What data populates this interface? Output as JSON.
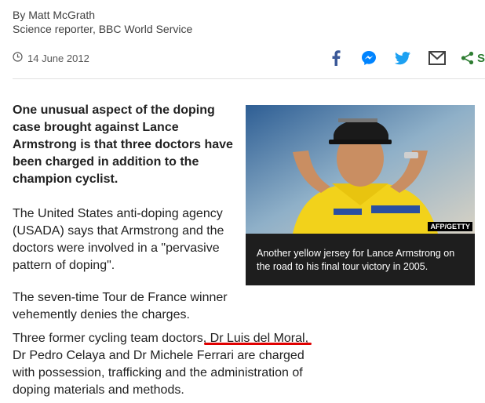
{
  "byline": {
    "author": "By Matt McGrath",
    "role": "Science reporter, BBC World Service"
  },
  "meta": {
    "date": "14 June 2012",
    "icons": [
      "clock-icon",
      "facebook-icon",
      "messenger-icon",
      "twitter-icon",
      "email-icon",
      "share-icon"
    ],
    "share_label": "S"
  },
  "article": {
    "lead": "One unusual aspect of the doping case brought against Lance Armstrong is that three doctors have been charged in addition to the champion cyclist.",
    "p1": "The United States anti-doping agency (USADA) says that Armstrong and the doctors were involved in a \"pervasive pattern of doping\".",
    "p2": "The seven-time Tour de France winner vehemently denies the charges.",
    "p3_before": "Three former cycling team doctors, ",
    "p3_link": "Dr Luis del Moral",
    "p3_after": ", Dr Pedro Celaya and Dr Michele Ferrari are charged with possession, trafficking and the administration of doping materials and methods."
  },
  "figure": {
    "credit": "AFP/GETTY",
    "caption": "Another yellow jersey for Lance Armstrong on the road to his final tour victory in 2005."
  },
  "colors": {
    "facebook": "#3b5998",
    "messenger": "#0084ff",
    "twitter": "#1da1f2",
    "email": "#404040",
    "share": "#2e7d32",
    "highlight": "#e00000",
    "jersey": "#f2d21b"
  }
}
